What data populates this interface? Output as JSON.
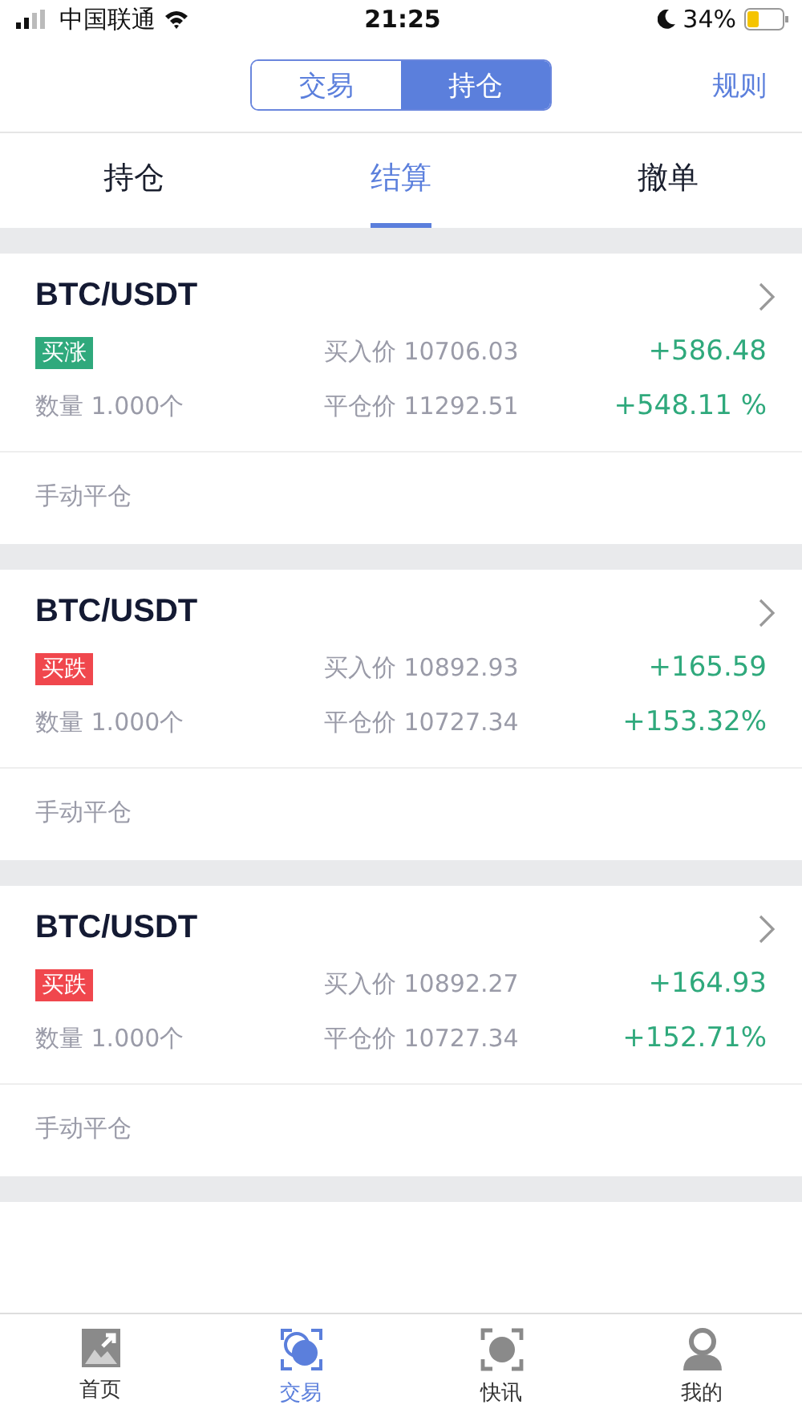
{
  "status_bar": {
    "carrier": "中国联通",
    "time": "21:25",
    "battery": "34%"
  },
  "header": {
    "segments": [
      {
        "label": "交易",
        "selected": false
      },
      {
        "label": "持仓",
        "selected": true
      }
    ],
    "rules_link": "规则"
  },
  "tabs": [
    {
      "label": "持仓",
      "selected": false
    },
    {
      "label": "结算",
      "selected": true
    },
    {
      "label": "撤单",
      "selected": false
    }
  ],
  "positions": [
    {
      "pair": "BTC/USDT",
      "color": "#2fa97c",
      "direction_label": "买涨",
      "buy_price": "买入价 10706.03",
      "quantity": "数量 1.000个",
      "close_price": "平仓价 11292.51",
      "profit": "+586.48",
      "profit_rate": "+548.11 %",
      "close_type": "手动平仓"
    },
    {
      "pair": "BTC/USDT",
      "color": "#f0474d",
      "direction_label": "买跌",
      "buy_price": "买入价 10892.93",
      "quantity": "数量 1.000个",
      "close_price": "平仓价 10727.34",
      "profit": "+165.59",
      "profit_rate": "+153.32%",
      "close_type": "手动平仓"
    },
    {
      "pair": "BTC/USDT",
      "color": "#f0474d",
      "direction_label": "买跌",
      "buy_price": "买入价 10892.27",
      "quantity": "数量 1.000个",
      "close_price": "平仓价 10727.34",
      "profit": "+164.93",
      "profit_rate": "+152.71%",
      "close_type": "手动平仓"
    }
  ],
  "tab_bar": [
    {
      "label": "首页",
      "selected": false
    },
    {
      "label": "交易",
      "selected": true
    },
    {
      "label": "快讯",
      "selected": false
    },
    {
      "label": "我的",
      "selected": false
    }
  ]
}
